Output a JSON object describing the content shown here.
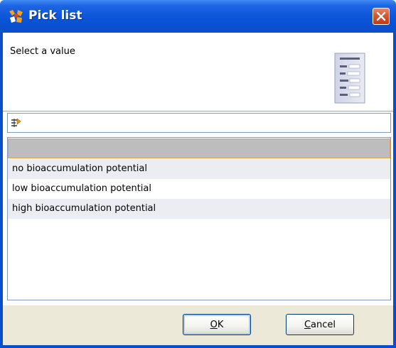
{
  "window": {
    "title": "Pick list",
    "close_icon": "close-icon"
  },
  "header": {
    "prompt": "Select a value"
  },
  "filter": {
    "value": "",
    "icon": "filter-icon"
  },
  "list": {
    "selected_index": 0,
    "items": [
      {
        "label": ""
      },
      {
        "label": "no bioaccumulation potential"
      },
      {
        "label": "low bioaccumulation potential"
      },
      {
        "label": "high bioaccumulation potential"
      }
    ]
  },
  "buttons": {
    "ok": {
      "mnemonic": "O",
      "rest": "K"
    },
    "cancel": {
      "mnemonic": "C",
      "rest": "ancel"
    }
  },
  "colors": {
    "titlebar": "#0a53d8",
    "selection": "#bdbdbd",
    "selection_border": "#e0a24a",
    "alt_row": "#ebedf3"
  }
}
